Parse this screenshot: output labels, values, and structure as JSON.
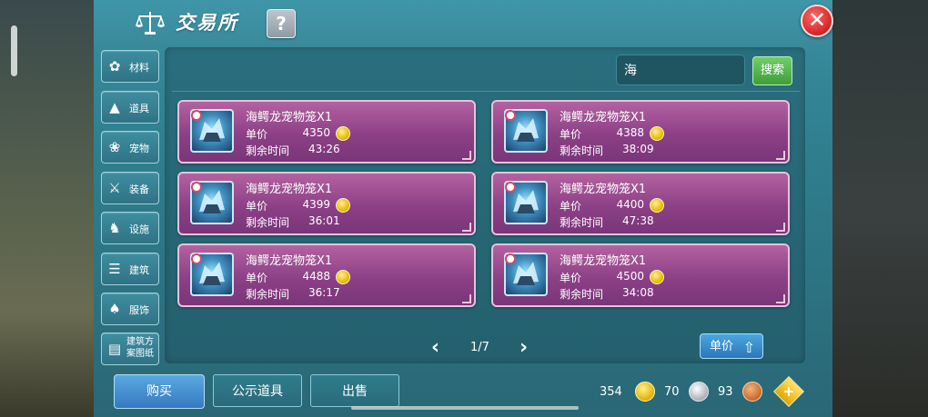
{
  "header": {
    "title": "交易所",
    "help_label": "?",
    "close_label": "✕"
  },
  "categories": [
    {
      "label": "材料",
      "icon": "materials-icon"
    },
    {
      "label": "道具",
      "icon": "flask-icon"
    },
    {
      "label": "宠物",
      "icon": "paw-icon"
    },
    {
      "label": "装备",
      "icon": "sword-icon"
    },
    {
      "label": "设施",
      "icon": "facility-icon"
    },
    {
      "label": "建筑",
      "icon": "building-icon"
    },
    {
      "label": "服饰",
      "icon": "clothing-icon"
    },
    {
      "label": "建筑方案图纸",
      "icon": "blueprint-icon"
    }
  ],
  "search": {
    "value": "海",
    "button_label": "搜索"
  },
  "listings": [
    {
      "name": "海鳄龙宠物笼X1",
      "price_label": "单价",
      "price": "4350",
      "time_label": "剩余时间",
      "time": "43:26"
    },
    {
      "name": "海鳄龙宠物笼X1",
      "price_label": "单价",
      "price": "4388",
      "time_label": "剩余时间",
      "time": "38:09"
    },
    {
      "name": "海鳄龙宠物笼X1",
      "price_label": "单价",
      "price": "4399",
      "time_label": "剩余时间",
      "time": "36:01"
    },
    {
      "name": "海鳄龙宠物笼X1",
      "price_label": "单价",
      "price": "4400",
      "time_label": "剩余时间",
      "time": "47:38"
    },
    {
      "name": "海鳄龙宠物笼X1",
      "price_label": "单价",
      "price": "4488",
      "time_label": "剩余时间",
      "time": "36:17"
    },
    {
      "name": "海鳄龙宠物笼X1",
      "price_label": "单价",
      "price": "4500",
      "time_label": "剩余时间",
      "time": "34:08"
    }
  ],
  "pager": {
    "page": "1/7"
  },
  "sort": {
    "label": "单价"
  },
  "bottom": {
    "buy_label": "购买",
    "public_label": "公示道具",
    "sell_label": "出售"
  },
  "currency": {
    "gold": "354",
    "silver": "70",
    "bronze": "93"
  },
  "colors": {
    "card": "#8c4086",
    "panel": "#2f7f8f",
    "accent_blue": "#3579c0",
    "search_green": "#3f9e3a"
  }
}
